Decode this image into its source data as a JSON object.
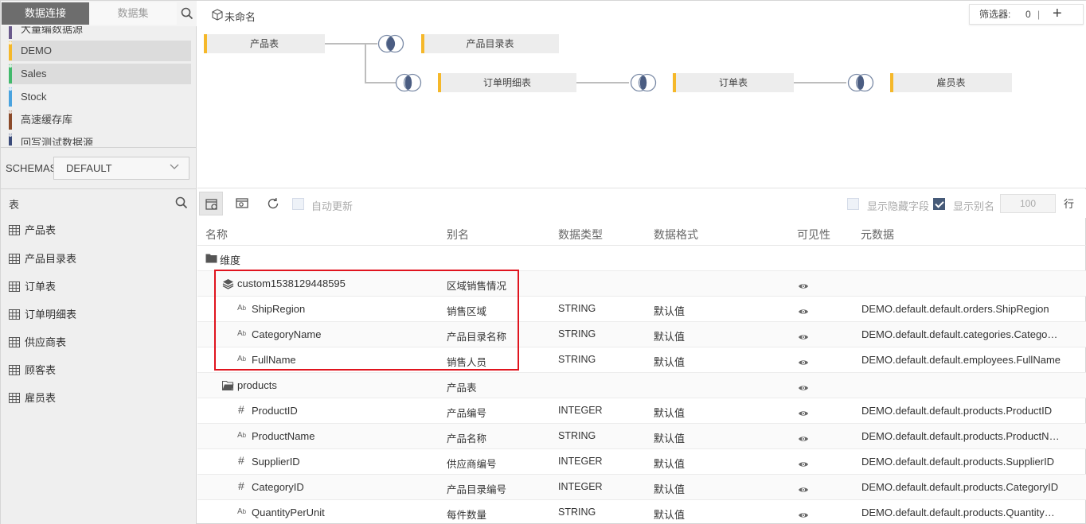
{
  "left": {
    "tabs": [
      "数据连接",
      "数据集"
    ],
    "connections": [
      {
        "label": "大量编数据源",
        "color": "#6a5a8c"
      },
      {
        "label": "DEMO",
        "color": "#f5b82a"
      },
      {
        "label": "Sales",
        "color": "#42b96c"
      },
      {
        "label": "Stock",
        "color": "#4aa3df"
      },
      {
        "label": "高速缓存库",
        "color": "#8b4a2a"
      },
      {
        "label": "回写测试数据源",
        "color": "#3b4b7a"
      }
    ],
    "schemas_label": "SCHEMAS",
    "schemas_value": "DEFAULT",
    "tables_header": "表",
    "tables": [
      "产品表",
      "产品目录表",
      "订单表",
      "订单明细表",
      "供应商表",
      "顾客表",
      "雇员表"
    ]
  },
  "diagram": {
    "title": "未命名",
    "filter_label": "筛选器:",
    "filter_count": "0",
    "filter_sep": "|",
    "filter_add": "+",
    "nodes": [
      "产品表",
      "产品目录表",
      "订单明细表",
      "订单表",
      "雇员表"
    ]
  },
  "toolbar": {
    "auto_update": "自动更新",
    "show_hidden": "显示隐藏字段",
    "show_alias": "显示别名",
    "row_count": "100",
    "row_label": "行"
  },
  "grid": {
    "headers": [
      "名称",
      "别名",
      "数据类型",
      "数据格式",
      "可见性",
      "元数据"
    ],
    "rows": [
      {
        "kind": "folder",
        "name": "维度",
        "alias": "",
        "type": "",
        "format": "",
        "meta": ""
      },
      {
        "kind": "layer",
        "name": "custom1538129448595",
        "alias": "区域销售情况",
        "type": "",
        "format": "",
        "meta": ""
      },
      {
        "kind": "text",
        "name": "ShipRegion",
        "alias": "销售区域",
        "type": "STRING",
        "format": "默认值",
        "meta": "DEMO.default.default.orders.ShipRegion"
      },
      {
        "kind": "text",
        "name": "CategoryName",
        "alias": "产品目录名称",
        "type": "STRING",
        "format": "默认值",
        "meta": "DEMO.default.default.categories.CategoryName"
      },
      {
        "kind": "text",
        "name": "FullName",
        "alias": "销售人员",
        "type": "STRING",
        "format": "默认值",
        "meta": "DEMO.default.default.employees.FullName"
      },
      {
        "kind": "subfolder",
        "name": "products",
        "alias": "产品表",
        "type": "",
        "format": "",
        "meta": ""
      },
      {
        "kind": "num",
        "name": "ProductID",
        "alias": "产品编号",
        "type": "INTEGER",
        "format": "默认值",
        "meta": "DEMO.default.default.products.ProductID"
      },
      {
        "kind": "text",
        "name": "ProductName",
        "alias": "产品名称",
        "type": "STRING",
        "format": "默认值",
        "meta": "DEMO.default.default.products.ProductName"
      },
      {
        "kind": "num",
        "name": "SupplierID",
        "alias": "供应商编号",
        "type": "INTEGER",
        "format": "默认值",
        "meta": "DEMO.default.default.products.SupplierID"
      },
      {
        "kind": "num",
        "name": "CategoryID",
        "alias": "产品目录编号",
        "type": "INTEGER",
        "format": "默认值",
        "meta": "DEMO.default.default.products.CategoryID"
      },
      {
        "kind": "text",
        "name": "QuantityPerUnit",
        "alias": "每件数量",
        "type": "STRING",
        "format": "默认值",
        "meta": "DEMO.default.default.products.QuantityPerUnit"
      }
    ]
  }
}
